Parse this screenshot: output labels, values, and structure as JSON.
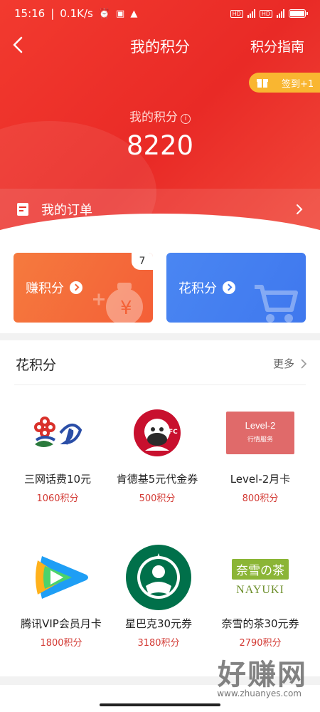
{
  "status": {
    "time": "15:16",
    "speed": "0.1K/s"
  },
  "header": {
    "title": "我的积分",
    "guide_label": "积分指南"
  },
  "signin": {
    "label": "签到+1"
  },
  "points": {
    "label": "我的积分",
    "value": "8220"
  },
  "orders": {
    "label": "我的订单"
  },
  "cards": {
    "earn": {
      "label": "赚积分",
      "badge": "7"
    },
    "spend": {
      "label": "花积分"
    }
  },
  "spend_section": {
    "title": "花积分",
    "more_label": "更多",
    "items": [
      {
        "name": "三网话费10元",
        "price": "1060积分",
        "icon": "telecom-logos"
      },
      {
        "name": "肯德基5元代金券",
        "price": "500积分",
        "icon": "kfc-logo"
      },
      {
        "name": "Level-2月卡",
        "price": "800积分",
        "icon": "level2-card",
        "card_title": "Level-2",
        "card_sub": "行情服务"
      },
      {
        "name": "腾讯VIP会员月卡",
        "price": "1800积分",
        "icon": "tencent-video-logo"
      },
      {
        "name": "星巴克30元券",
        "price": "3180积分",
        "icon": "starbucks-logo"
      },
      {
        "name": "奈雪的茶30元券",
        "price": "2790积分",
        "icon": "nayuki-logo",
        "logo_text": "奈雪の茶",
        "logo_en": "NAYUKI"
      }
    ]
  },
  "watermark": {
    "text": "好赚网",
    "sub": "www.zhuanyes.com"
  },
  "colors": {
    "brand_red": "#ea2e27",
    "earn_orange": "#f4663a",
    "spend_blue": "#427cef",
    "price_red": "#d33a34",
    "signin_yellow": "#f9b631"
  }
}
